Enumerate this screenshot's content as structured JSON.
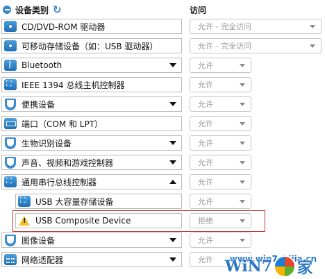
{
  "header": {
    "device_class_label": "设备类别",
    "access_label": "访问"
  },
  "rows": [
    {
      "label": "CD/DVD-ROM 驱动器",
      "icon": "disc-drive-icon",
      "access": "允许 - 完全访问",
      "expand": ""
    },
    {
      "label": "可移动存储设备（如：USB 驱动器）",
      "icon": "removable-storage-icon",
      "access": "允许 - 完全访问",
      "expand": ""
    },
    {
      "label": "Bluetooth",
      "icon": "bluetooth-icon",
      "access": "允许",
      "expand": "down"
    },
    {
      "label": "IEEE 1394 总线主机控制器",
      "icon": "firewire-icon",
      "access": "允许",
      "expand": ""
    },
    {
      "label": "便携设备",
      "icon": "shield-icon",
      "access": "允许",
      "expand": "down"
    },
    {
      "label": "端口（COM 和 LPT）",
      "icon": "port-icon",
      "access": "允许",
      "expand": ""
    },
    {
      "label": "生物识别设备",
      "icon": "shield-icon",
      "access": "允许",
      "expand": "down"
    },
    {
      "label": "声音、视频和游戏控制器",
      "icon": "shield-icon",
      "access": "允许",
      "expand": "down"
    },
    {
      "label": "通用串行总线控制器",
      "icon": "usb-controller-icon",
      "access": "允许",
      "expand": "up"
    },
    {
      "label": "USB 大容量存储设备",
      "icon": "usb-storage-icon",
      "access": "允许",
      "expand": ""
    },
    {
      "label": "USB Composite Device",
      "icon": "warning-icon",
      "access": "拒绝",
      "expand": ""
    },
    {
      "label": "图像设备",
      "icon": "shield-icon",
      "access": "允许",
      "expand": "down"
    },
    {
      "label": "网络适配器",
      "icon": "network-adapter-icon",
      "access": "允许",
      "expand": "down"
    }
  ],
  "watermark": {
    "url": "www.win7zhijia.cn",
    "logo_text_left": "WiN7",
    "logo_text_right": "家"
  }
}
